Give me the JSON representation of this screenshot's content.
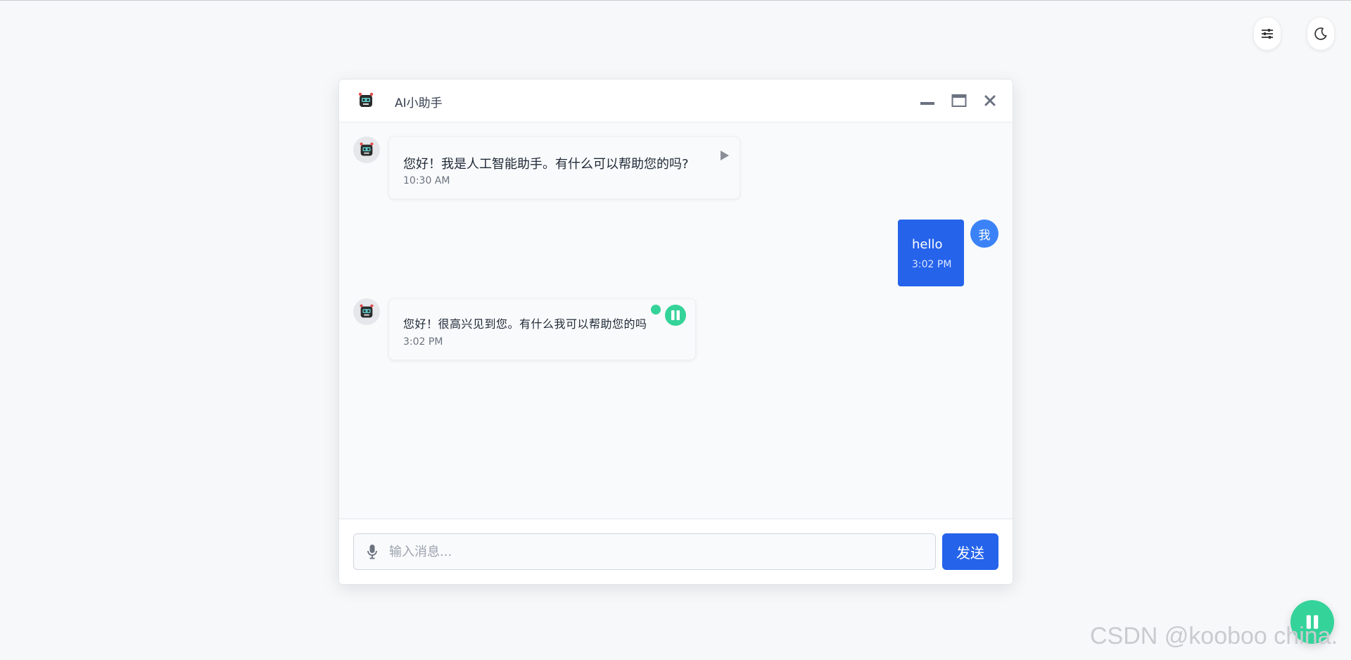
{
  "chat": {
    "title": "AI小助手",
    "messages": [
      {
        "role": "bot",
        "text": "您好！我是人工智能助手。有什么可以帮助您的吗?",
        "time": "10:30 AM"
      },
      {
        "role": "user",
        "avatar_text": "我",
        "text": "hello",
        "time": "3:02 PM"
      },
      {
        "role": "bot",
        "text": "您好！很高兴见到您。有什么我可以帮助您的吗",
        "time": "3:02 PM"
      }
    ]
  },
  "input": {
    "placeholder": "输入消息..."
  },
  "send": {
    "label": "发送"
  },
  "watermark": "CSDN @kooboo china.",
  "colors": {
    "accent": "#2563eb",
    "user_avatar": "#3b82f6",
    "voice_active": "#34d399",
    "background": "#f7f8fa"
  },
  "icons": [
    "settings-sliders-icon",
    "moon-icon",
    "robot-icon",
    "minimize-icon",
    "maximize-icon",
    "close-icon",
    "play-icon",
    "pause-icon",
    "microphone-icon"
  ]
}
